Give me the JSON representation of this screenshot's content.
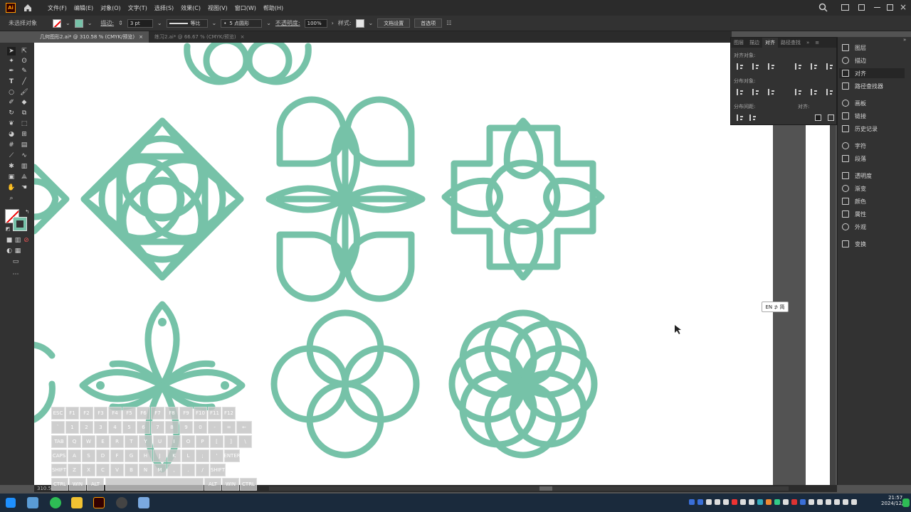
{
  "app": {
    "logo_text": "Ai"
  },
  "menu": [
    "文件(F)",
    "编辑(E)",
    "对象(O)",
    "文字(T)",
    "选择(S)",
    "效果(C)",
    "视图(V)",
    "窗口(W)",
    "帮助(H)"
  ],
  "control_bar": {
    "no_selection": "未选择对象",
    "stroke_label": "描边:",
    "stroke_value": "3 pt",
    "profile_label": "等比",
    "brush_label": "5 点圆形",
    "opacity_label": "不透明度:",
    "opacity_value": "100%",
    "style_label": "样式:",
    "doc_setup": "文档设置",
    "preferences": "首选项"
  },
  "tabs": [
    {
      "label": "几何图形2.ai* @ 310.58 % (CMYK/预览)",
      "active": true
    },
    {
      "label": "练习2.ai* @ 66.67 % (CMYK/预览)",
      "active": false
    }
  ],
  "align_panel": {
    "tabs": [
      "图层",
      "描边",
      "对齐",
      "路径查找"
    ],
    "active_tab": "对齐",
    "align_objects": "对齐对象:",
    "distribute_objects": "分布对象:",
    "distribute_spacing": "分布间距:",
    "align_to": "对齐:"
  },
  "right_panel": {
    "items": [
      {
        "label": "图层",
        "icon": "layers-icon"
      },
      {
        "label": "描边",
        "icon": "stroke-icon"
      },
      {
        "label": "对齐",
        "icon": "align-icon",
        "active": true
      },
      {
        "label": "路径查找器",
        "icon": "pathfinder-icon"
      },
      {
        "label": "画板",
        "icon": "artboard-icon"
      },
      {
        "label": "链接",
        "icon": "link-icon"
      },
      {
        "label": "历史记录",
        "icon": "history-icon"
      },
      {
        "label": "字符",
        "icon": "character-icon"
      },
      {
        "label": "段落",
        "icon": "paragraph-icon"
      },
      {
        "label": "透明度",
        "icon": "transparency-icon"
      },
      {
        "label": "渐变",
        "icon": "gradient-icon"
      },
      {
        "label": "颜色",
        "icon": "color-icon"
      },
      {
        "label": "属性",
        "icon": "properties-icon"
      },
      {
        "label": "外观",
        "icon": "appearance-icon"
      },
      {
        "label": "变换",
        "icon": "transform-icon"
      }
    ]
  },
  "status": {
    "zoom": "310.5"
  },
  "ime": {
    "label": "EN ⊅ 简"
  },
  "clock": {
    "time": "21:57",
    "date": "2024/12/16"
  },
  "keyboard": {
    "row1": [
      "ESC",
      "F1",
      "F2",
      "F3",
      "F4",
      "F5",
      "F6",
      "F7",
      "F8",
      "F9",
      "F10",
      "F11",
      "F12"
    ],
    "row2": [
      "`",
      "1",
      "2",
      "3",
      "4",
      "5",
      "6",
      "7",
      "8",
      "9",
      "0",
      "-",
      "=",
      "←"
    ],
    "row3": [
      "TAB",
      "Q",
      "W",
      "E",
      "R",
      "T",
      "Y",
      "U",
      "I",
      "O",
      "P",
      "[",
      "]",
      "\\"
    ],
    "row4": [
      "CAPS",
      "A",
      "S",
      "D",
      "F",
      "G",
      "H",
      "J",
      "K",
      "L",
      ";",
      "'",
      "ENTER"
    ],
    "row5": [
      "SHIFT",
      "Z",
      "X",
      "C",
      "V",
      "B",
      "N",
      "M",
      ",",
      ".",
      "/",
      "SHIFT"
    ],
    "row6": [
      "CTRL",
      "WIN",
      "ALT",
      "ALT",
      "WIN",
      "CTRL"
    ]
  },
  "colors": {
    "motif": "#76c2a8",
    "accent": "#ff9a00"
  }
}
